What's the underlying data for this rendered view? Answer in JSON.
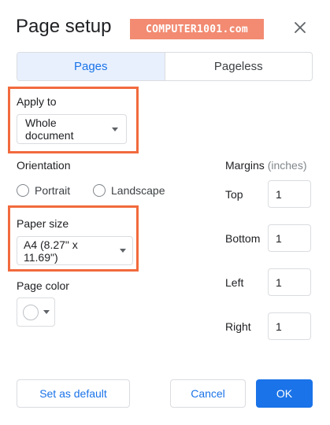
{
  "dialog": {
    "title": "Page setup",
    "watermark": "COMPUTER1001.com"
  },
  "tabs": [
    {
      "label": "Pages",
      "active": true
    },
    {
      "label": "Pageless",
      "active": false
    }
  ],
  "apply_to": {
    "label": "Apply to",
    "value": "Whole document"
  },
  "orientation": {
    "label": "Orientation",
    "options": [
      {
        "label": "Portrait",
        "selected": false
      },
      {
        "label": "Landscape",
        "selected": false
      }
    ]
  },
  "paper_size": {
    "label": "Paper size",
    "value": "A4 (8.27\" x 11.69\")"
  },
  "page_color": {
    "label": "Page color",
    "value": "#ffffff"
  },
  "margins": {
    "label": "Margins",
    "unit": "(inches)",
    "top": {
      "label": "Top",
      "value": "1"
    },
    "bottom": {
      "label": "Bottom",
      "value": "1"
    },
    "left": {
      "label": "Left",
      "value": "1"
    },
    "right": {
      "label": "Right",
      "value": "1"
    }
  },
  "footer": {
    "set_default": "Set as default",
    "cancel": "Cancel",
    "ok": "OK"
  },
  "colors": {
    "accent": "#1a73e8",
    "highlight": "#f26a3d",
    "watermark_bg": "#f28b72"
  },
  "icons": {
    "close": "close-icon",
    "caret": "caret-down-icon"
  }
}
